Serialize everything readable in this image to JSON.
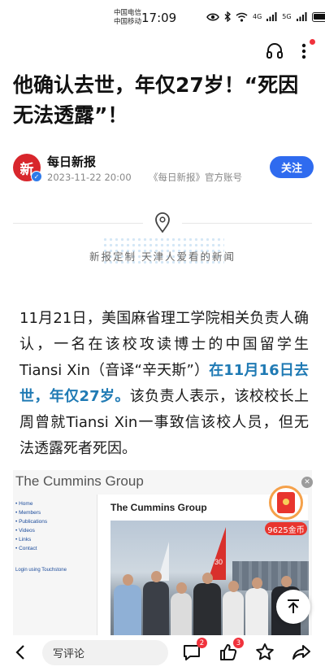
{
  "status_bar": {
    "carrier_line1": "中国电信",
    "carrier_line2": "中国移动",
    "time": "17:09",
    "signal_label_1": "4G",
    "signal_label_2": "5G"
  },
  "article": {
    "title": "他确认去世，年仅27岁！“死因无法透露”！",
    "author": {
      "name": "每日新报",
      "avatar_text": "新",
      "date": "2023-11-22 20:00",
      "source": "《每日新报》官方账号",
      "follow_label": "关注"
    },
    "banner_text": "新报定制 天津人爱看的新闻",
    "body": {
      "part1": "11月21日，美国麻省理工学院相关负责人确认，一名在该校攻读博士的中国留学生Tiansi Xin（音译“辛天斯”）",
      "highlight": "在11月16日去世，年仅27岁。",
      "part2": "该负责人表示，该校校长上周曾就Tiansi Xin一事致信该校人员，但无法透露死者死因。"
    },
    "image": {
      "site_title": "The Cummins Group",
      "nav_items": [
        "Home",
        "Members",
        "Publications",
        "Videos",
        "Links",
        "Contact"
      ],
      "login_text": "Login using Touchstone",
      "panel_title": "The Cummins Group",
      "sail_number": "30"
    }
  },
  "overlay": {
    "coin_label": "9625金币"
  },
  "bottom_bar": {
    "comment_placeholder": "写评论",
    "comment_count": "2",
    "like_count": "3"
  },
  "colors": {
    "accent_blue": "#2f6bef",
    "highlight_blue": "#1f7ab4",
    "badge_red": "#f0323c"
  }
}
